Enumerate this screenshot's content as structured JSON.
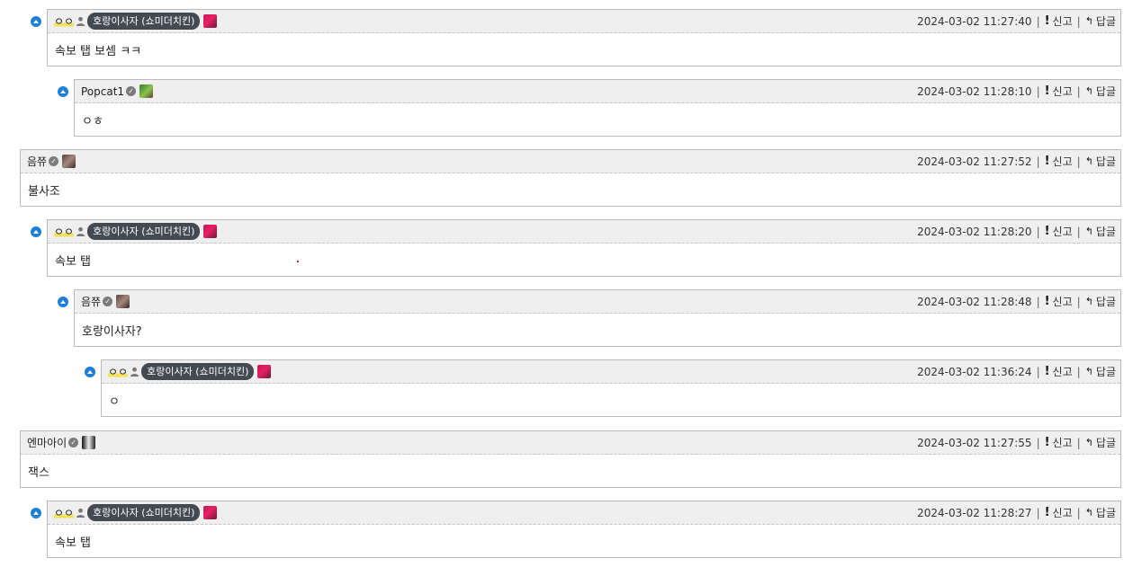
{
  "actions": {
    "report_label": "신고",
    "reply_label": "답글",
    "separator": "|"
  },
  "comments": [
    {
      "author": "ㅇㅇ",
      "badge": "호랑이사자 (쇼미더치킨)",
      "time": "2024-03-02 11:27:40",
      "body": "속보 탭 보셈 ㅋㅋ"
    },
    {
      "author": "Popcat1",
      "time": "2024-03-02 11:28:10",
      "body": "ㅇㅎ"
    },
    {
      "author": "음쮸",
      "time": "2024-03-02 11:27:52",
      "body": "불사조"
    },
    {
      "author": "ㅇㅇ",
      "badge": "호랑이사자 (쇼미더치킨)",
      "time": "2024-03-02 11:28:20",
      "body": "속보 탭"
    },
    {
      "author": "음쮸",
      "time": "2024-03-02 11:28:48",
      "body": "호랑이사자?"
    },
    {
      "author": "ㅇㅇ",
      "badge": "호랑이사자 (쇼미더치킨)",
      "time": "2024-03-02 11:36:24",
      "body": "ㅇ"
    },
    {
      "author": "엔마아이",
      "time": "2024-03-02 11:27:55",
      "body": "잭스"
    },
    {
      "author": "ㅇㅇ",
      "badge": "호랑이사자 (쇼미더치킨)",
      "time": "2024-03-02 11:28:27",
      "body": "속보 탭"
    }
  ]
}
